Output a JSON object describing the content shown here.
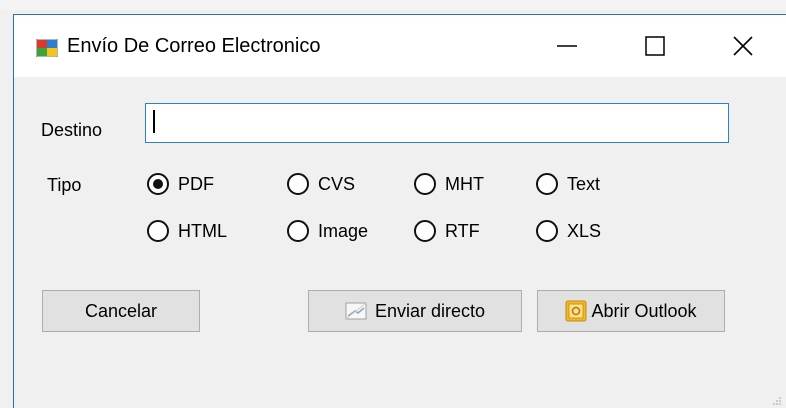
{
  "window": {
    "title": "Envío De Correo Electronico",
    "controls": {
      "minimize": "minimize-icon",
      "maximize": "maximize-icon",
      "close": "close-icon"
    }
  },
  "form": {
    "destino_label": "Destino",
    "destino_value": "",
    "tipo_label": "Tipo",
    "selected_tipo": "PDF",
    "options": [
      "PDF",
      "CVS",
      "MHT",
      "Text",
      "HTML",
      "Image",
      "RTF",
      "XLS"
    ]
  },
  "buttons": {
    "cancel": "Cancelar",
    "send": "Enviar directo",
    "outlook": "Abrir Outlook"
  },
  "colors": {
    "accent": "#2d7fd3",
    "button_bg": "#e1e1e1",
    "window_bg": "#f0f0f0"
  }
}
